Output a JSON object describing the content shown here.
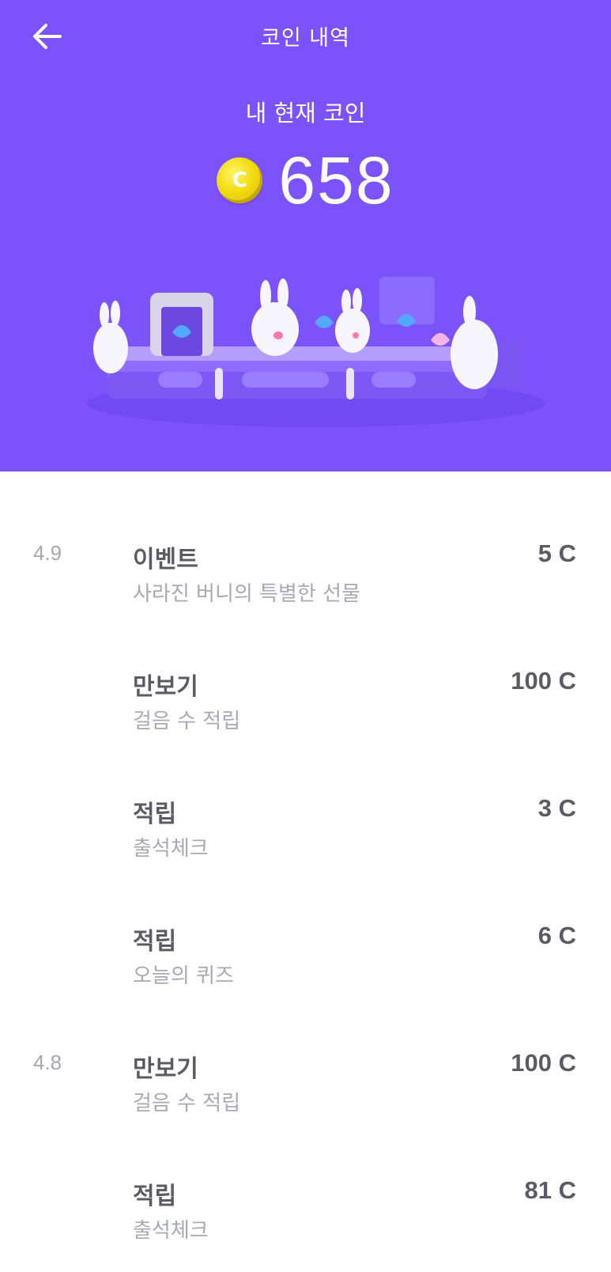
{
  "header": {
    "title": "코인 내역",
    "back_icon": "arrow-left-icon",
    "balance_label": "내 현재 코인",
    "coin_symbol": "C",
    "balance_value": "658",
    "background_color": "#7c53fb"
  },
  "history": [
    {
      "date": "4.9",
      "type": "이벤트",
      "desc": "사라진 버니의 특별한 선물",
      "amount": "5 C"
    },
    {
      "date": "",
      "type": "만보기",
      "desc": "걸음 수 적립",
      "amount": "100 C"
    },
    {
      "date": "",
      "type": "적립",
      "desc": "출석체크",
      "amount": "3 C"
    },
    {
      "date": "",
      "type": "적립",
      "desc": "오늘의 퀴즈",
      "amount": "6 C"
    },
    {
      "date": "4.8",
      "type": "만보기",
      "desc": "걸음 수 적립",
      "amount": "100 C"
    },
    {
      "date": "",
      "type": "적립",
      "desc": "출석체크",
      "amount": "81 C"
    }
  ]
}
